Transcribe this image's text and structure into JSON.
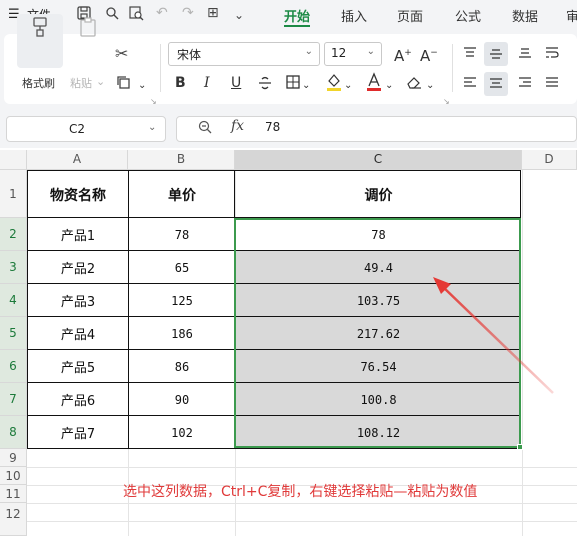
{
  "menu": {
    "file_label": "文件",
    "tabs": [
      {
        "label": "开始",
        "active": true
      },
      {
        "label": "插入",
        "active": false
      },
      {
        "label": "页面",
        "active": false
      },
      {
        "label": "公式",
        "active": false
      },
      {
        "label": "数据",
        "active": false
      },
      {
        "label": "审",
        "active": false
      }
    ]
  },
  "ribbon": {
    "format_painter_label": "格式刷",
    "paste_label": "粘贴",
    "font_name": "宋体",
    "font_size": "12",
    "bold": "B",
    "italic": "I",
    "underline": "U",
    "font_color_glyph": "A"
  },
  "formula_bar": {
    "name_box": "C2",
    "fx_label": "fx",
    "value": "78"
  },
  "sheet": {
    "columns": [
      "A",
      "B",
      "C",
      "D"
    ],
    "row_numbers": [
      "1",
      "2",
      "3",
      "4",
      "5",
      "6",
      "7",
      "8",
      "9",
      "10",
      "11",
      "12"
    ],
    "header_row": [
      "物资名称",
      "单价",
      "调价"
    ],
    "rows": [
      [
        "产品1",
        "78",
        "78"
      ],
      [
        "产品2",
        "65",
        "49.4"
      ],
      [
        "产品3",
        "125",
        "103.75"
      ],
      [
        "产品4",
        "186",
        "217.62"
      ],
      [
        "产品5",
        "86",
        "76.54"
      ],
      [
        "产品6",
        "90",
        "100.8"
      ],
      [
        "产品7",
        "102",
        "108.12"
      ]
    ]
  },
  "annotation_text": "选中这列数据，Ctrl+C复制，右键选择粘贴—粘贴为数值",
  "colors": {
    "accent_green": "#1c8a45",
    "selection_green": "#3c9a4e",
    "annotation_red": "#e03a3a"
  }
}
